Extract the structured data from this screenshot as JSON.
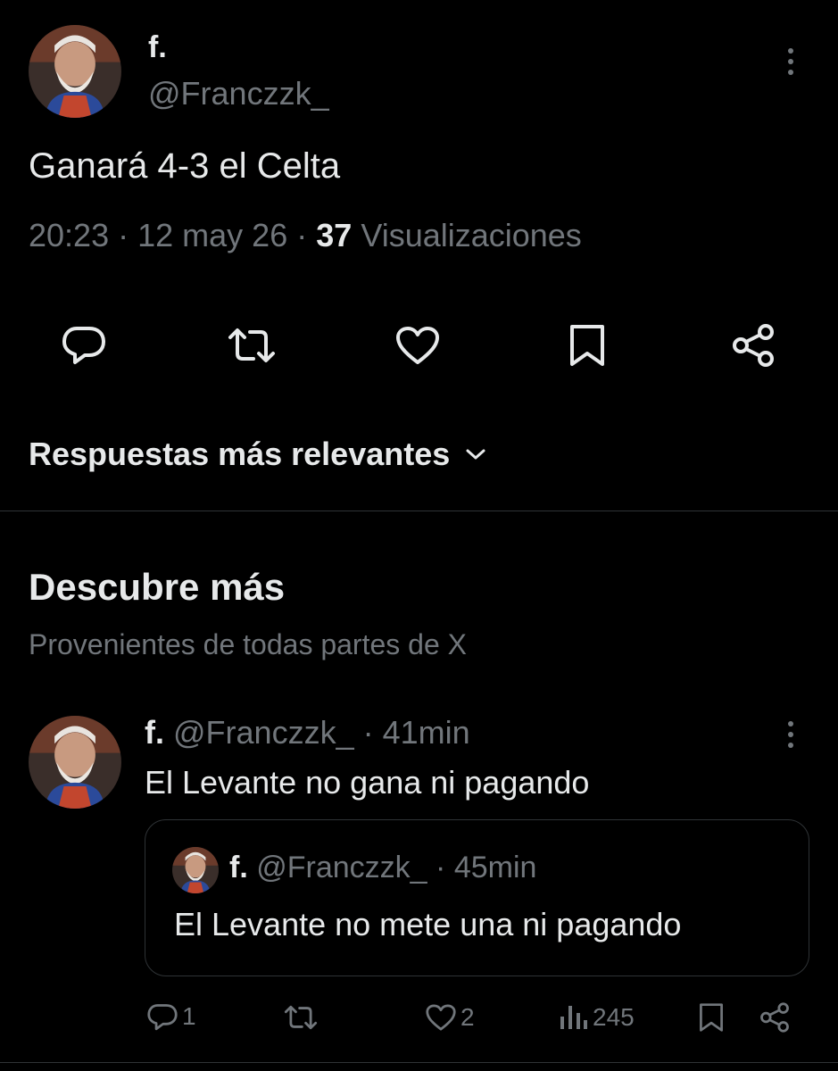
{
  "tweet": {
    "author_name": "f.",
    "author_handle": "@Franczzk_",
    "text": "Ganará 4-3 el Celta",
    "time": "20:23",
    "date": "12 may 26",
    "separator": "·",
    "views_count": "37",
    "views_label": "Visualizaciones"
  },
  "replies_sort": {
    "label": "Respuestas más relevantes"
  },
  "discover": {
    "title": "Descubre más",
    "subtitle": "Provenientes de todas partes de X"
  },
  "related_post": {
    "author_name": "f.",
    "author_handle": "@Franczzk_",
    "age": "41min",
    "text": "El Levante no gana ni pagando",
    "quote": {
      "author_name": "f.",
      "author_handle": "@Franczzk_",
      "age": "45min",
      "text": "El Levante no mete una ni pagando"
    },
    "stats": {
      "replies": "1",
      "likes": "2",
      "views": "245"
    }
  },
  "colors": {
    "background": "#000000",
    "text_primary": "#e7e9ea",
    "text_secondary": "#71767b",
    "divider": "#2f3336"
  }
}
